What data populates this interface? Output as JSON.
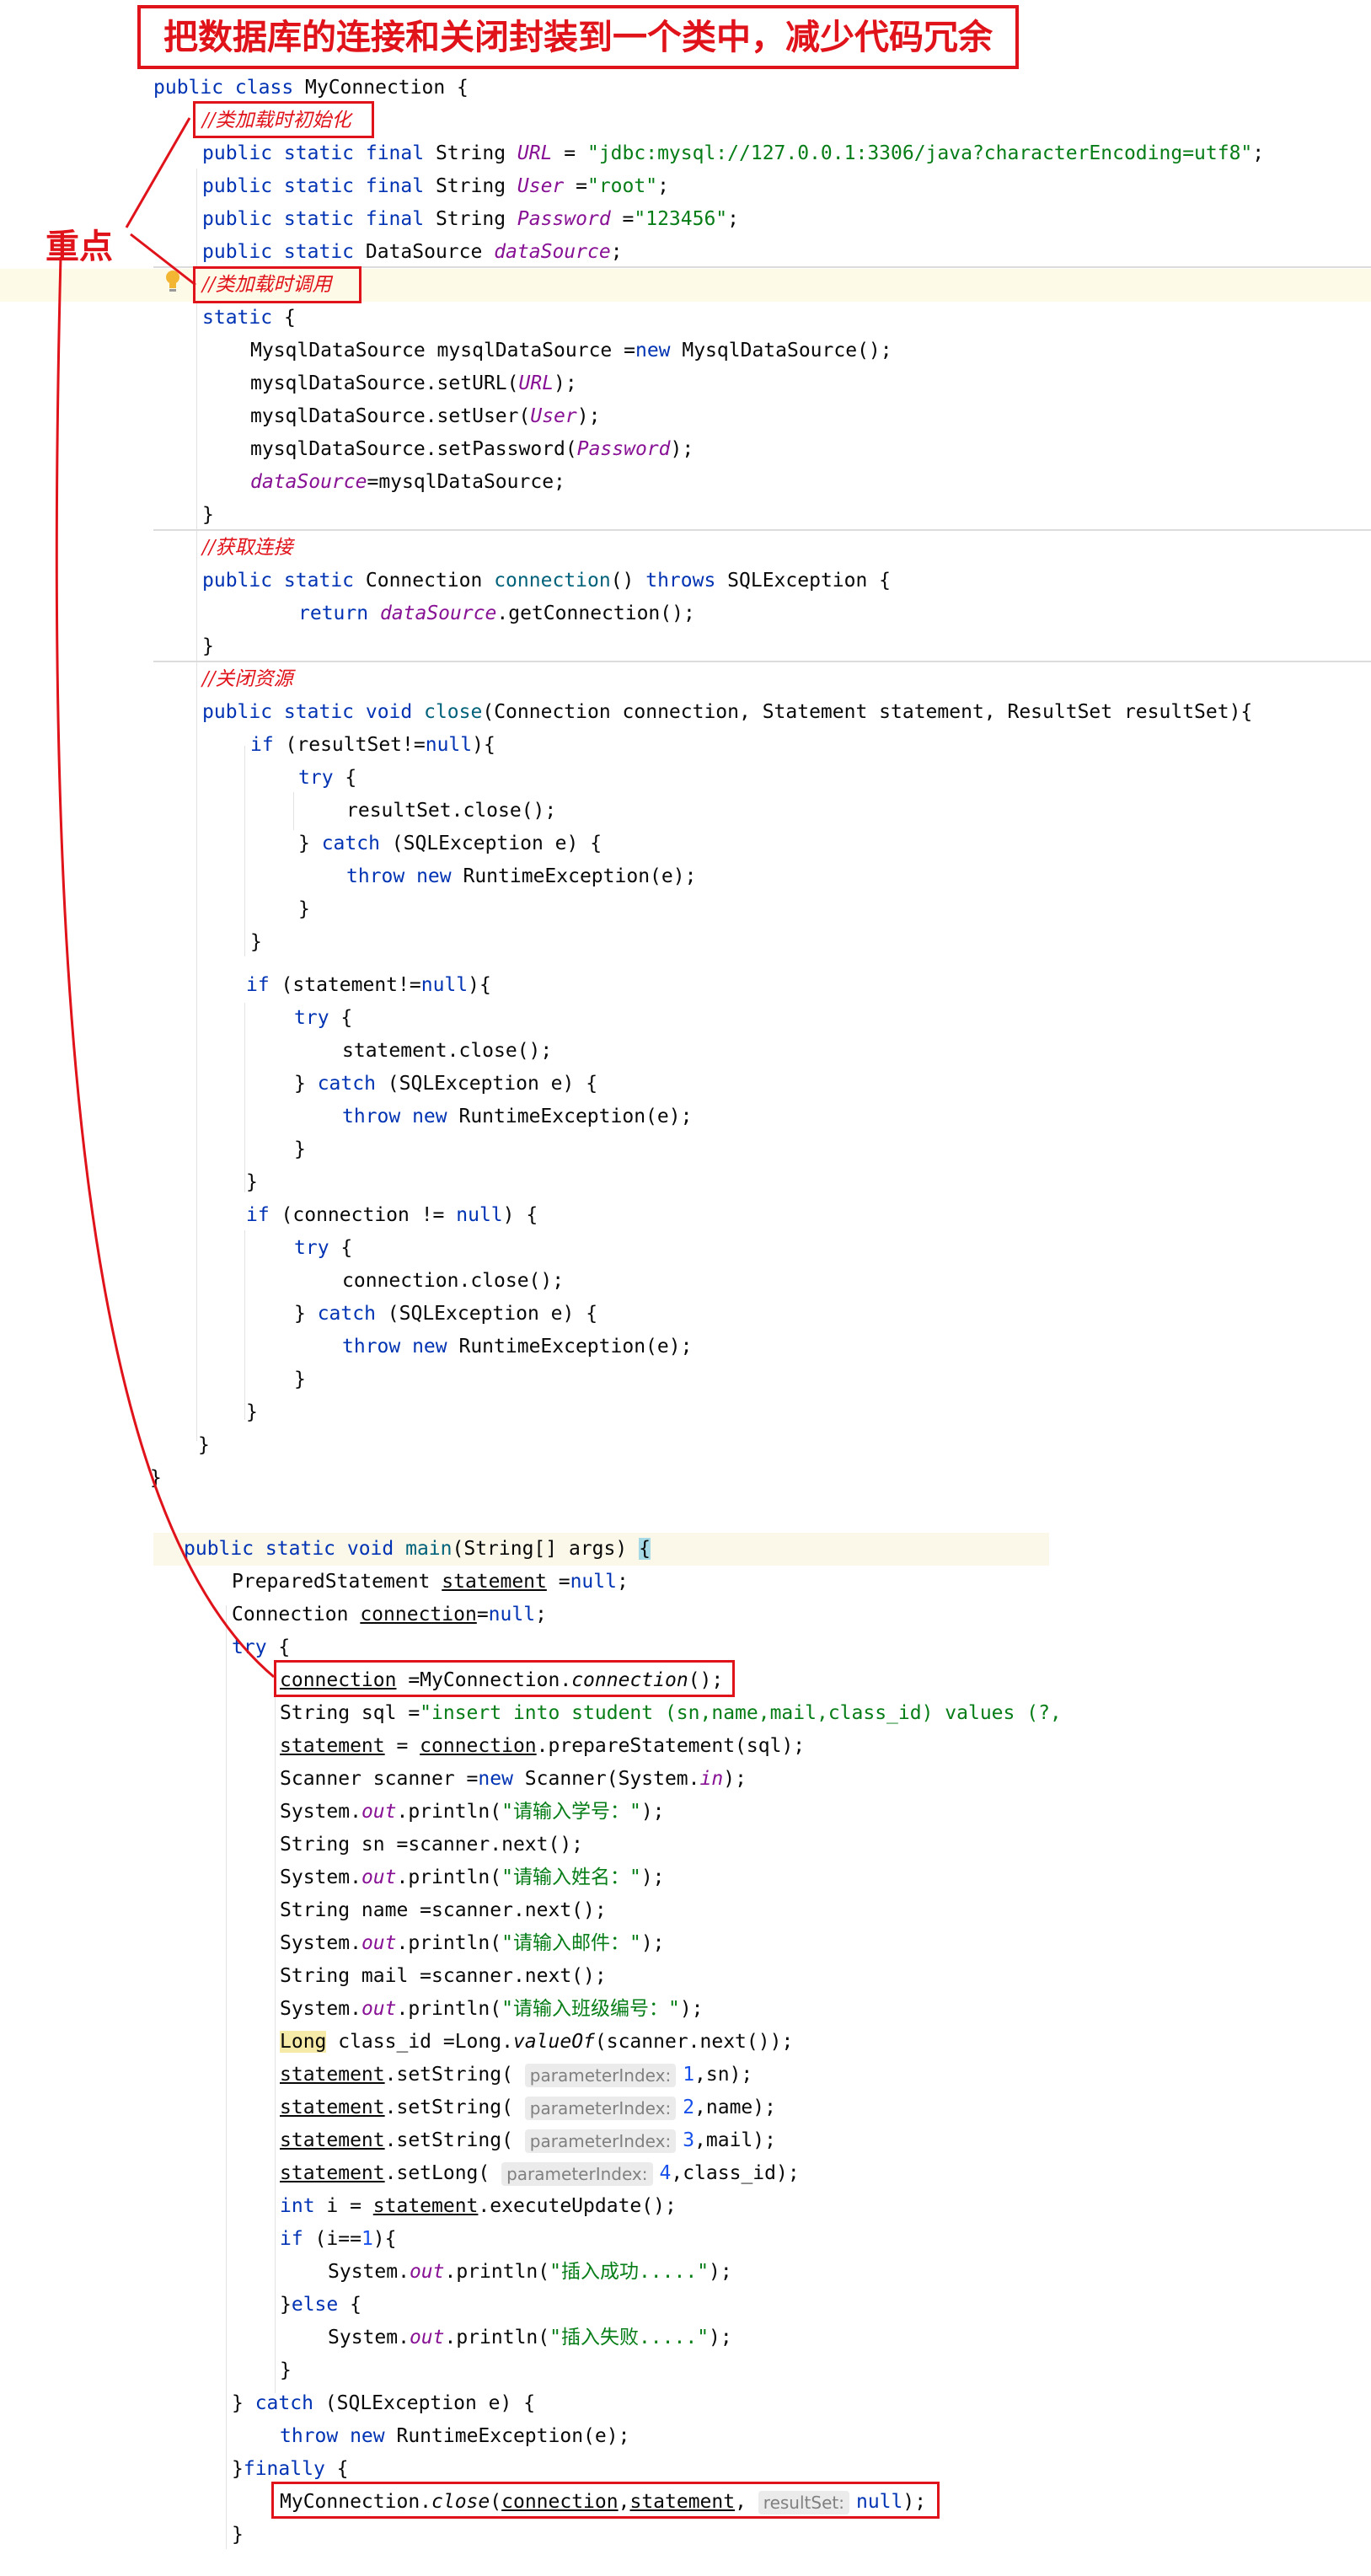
{
  "annotations": {
    "title": "把数据库的连接和关闭封装到一个类中，减少代码冗余",
    "key_point": "重点"
  },
  "code": {
    "l01": "MyConnection {",
    "l02": "//类加载时初始化",
    "l03_str": "\"jdbc:mysql://127.0.0.1:3306/java?characterEncoding=utf8\"",
    "l04_str": "\"root\"",
    "l05_str": "\"123456\"",
    "l07": "//类加载时调用",
    "cm_conn": "//获取连接",
    "cm_close": "//关闭资源",
    "sql_str": "\"insert into student (sn,name,mail,class_id) values (?,",
    "p_sn": "\"请输入学号：\"",
    "p_name": "\"请输入姓名：\"",
    "p_mail": "\"请输入邮件：\"",
    "p_class": "\"请输入班级编号：\"",
    "ok_str": "\"插入成功.....\"",
    "fail_str": "\"插入失败.....\"",
    "hint_param": "parameterIndex:",
    "hint_rs": "resultSet:"
  },
  "colors": {
    "accent_red": "#e0121a",
    "keyword": "#0033b3",
    "string": "#067d17",
    "number": "#1750eb",
    "field": "#871094"
  },
  "icons": {
    "bulb": "lightbulb-icon"
  }
}
